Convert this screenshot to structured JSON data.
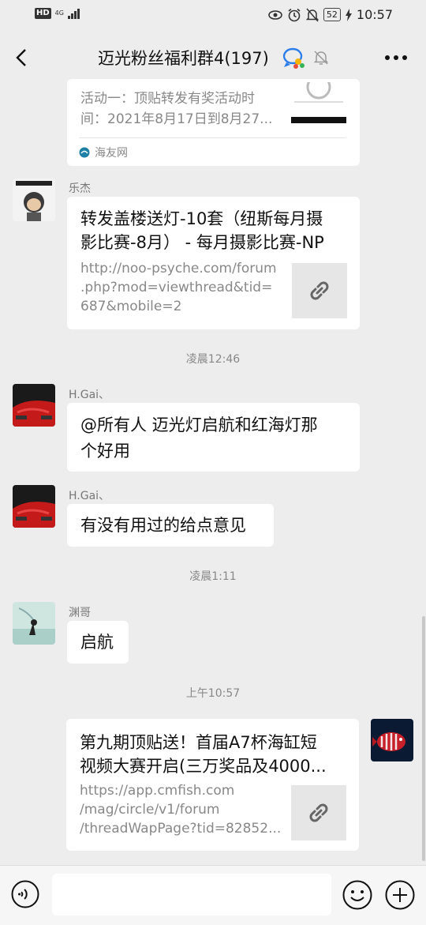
{
  "status_bar": {
    "hd": "HD",
    "network": "4G",
    "battery": "52",
    "time": "10:57"
  },
  "header": {
    "title": "迈光粉丝福利群4(197)"
  },
  "messages": {
    "m0": {
      "desc_line1": "活动一：顶贴转发有奖活动时",
      "desc_line2": "间：2021年8月17日到8月27...",
      "source": "海友网"
    },
    "m1": {
      "sender": "乐杰",
      "title_line1": "转发盖楼送灯-10套（纽斯每月摄",
      "title_line2": "影比赛-8月） - 每月摄影比赛-NP",
      "url_line1": "http://noo-psyche.com/forum",
      "url_line2": ".php?mod=viewthread&tid=",
      "url_line3": "687&mobile=2"
    },
    "ts1": "凌晨12:46",
    "m2": {
      "sender": "H.Gai、",
      "line1": "@所有人  迈光灯启航和红海灯那",
      "line2": "个好用"
    },
    "m3": {
      "sender": "H.Gai、",
      "text": "有没有用过的给点意见"
    },
    "ts2": "凌晨1:11",
    "m4": {
      "sender": "渊哥",
      "text": "启航"
    },
    "ts3": "上午10:57",
    "m5": {
      "title_line1": "第九期顶贴送！首届A7杯海缸短",
      "title_line2": "视频大赛开启(三万奖品及4000...",
      "url_line1": "https://app.cmfish.com",
      "url_line2": "/mag/circle/v1/forum",
      "url_line3": "/threadWapPage?tid=82852..."
    }
  }
}
